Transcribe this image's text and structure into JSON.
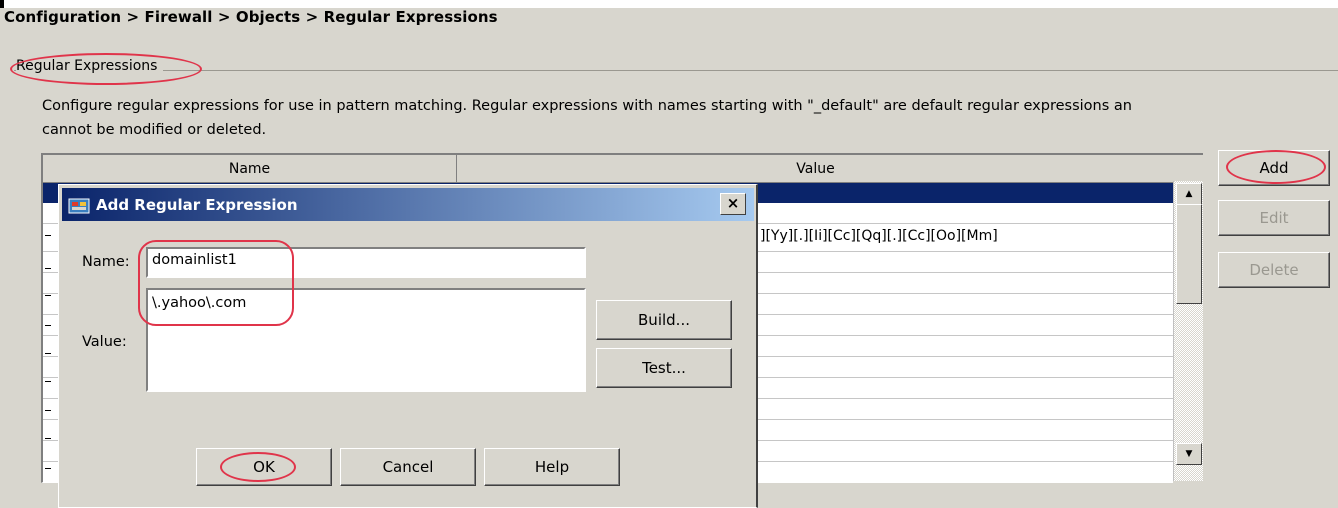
{
  "breadcrumb": "Configuration > Firewall > Objects > Regular Expressions",
  "group": {
    "label": "Regular Expressions",
    "description_line1": "Configure regular expressions for use in pattern matching. Regular expressions with names starting with \"_default\" are default regular expressions an",
    "description_line2": "cannot be modified or deleted."
  },
  "table": {
    "columns": [
      "Name",
      "Value"
    ],
    "visible_values": [
      "][Yy][.][Ii][Cc][Qq][.][Cc][Oo][Mm]"
    ]
  },
  "side_buttons": {
    "add": "Add",
    "edit": "Edit",
    "delete": "Delete"
  },
  "dialog": {
    "title": "Add Regular Expression",
    "close": "×",
    "name_label": "Name:",
    "name_value": "domainlist1",
    "value_label": "Value:",
    "value_text": "\\.yahoo\\.com",
    "build_button": "Build...",
    "test_button": "Test...",
    "ok_button": "OK",
    "cancel_button": "Cancel",
    "help_button": "Help"
  },
  "colors": {
    "selection": "#0a246a",
    "highlight_ring": "#e0344a",
    "title_gradient_end": "#a6caf0"
  }
}
